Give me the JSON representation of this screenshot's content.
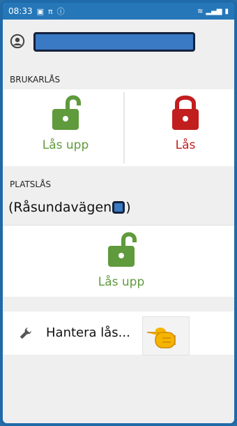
{
  "status": {
    "time": "08:33",
    "left_icons": [
      "gallery-icon",
      "pi-icon",
      "info-icon"
    ],
    "right_icons": [
      "wifi-icon",
      "signal-icon",
      "battery-icon"
    ]
  },
  "user": {
    "icon": "user-icon",
    "name_redacted": ""
  },
  "brukarlas": {
    "label": "BRUKARLÅS",
    "unlock": {
      "label": "Lås upp",
      "icon": "unlocked-padlock-icon",
      "color": "#5f9a3c"
    },
    "lock": {
      "label": "Lås",
      "icon": "locked-padlock-icon",
      "color": "#c21e1e"
    }
  },
  "platslas": {
    "label": "PLATSLÅS",
    "place_prefix": "(Råsundavägen",
    "place_suffix": ")",
    "unlock": {
      "label": "Lås upp",
      "icon": "unlocked-padlock-icon",
      "color": "#5f9a3c"
    }
  },
  "menu": {
    "manage": {
      "label": "Hantera lås...",
      "icon": "wrench-icon"
    },
    "pointer": "pointing-hand-icon"
  }
}
